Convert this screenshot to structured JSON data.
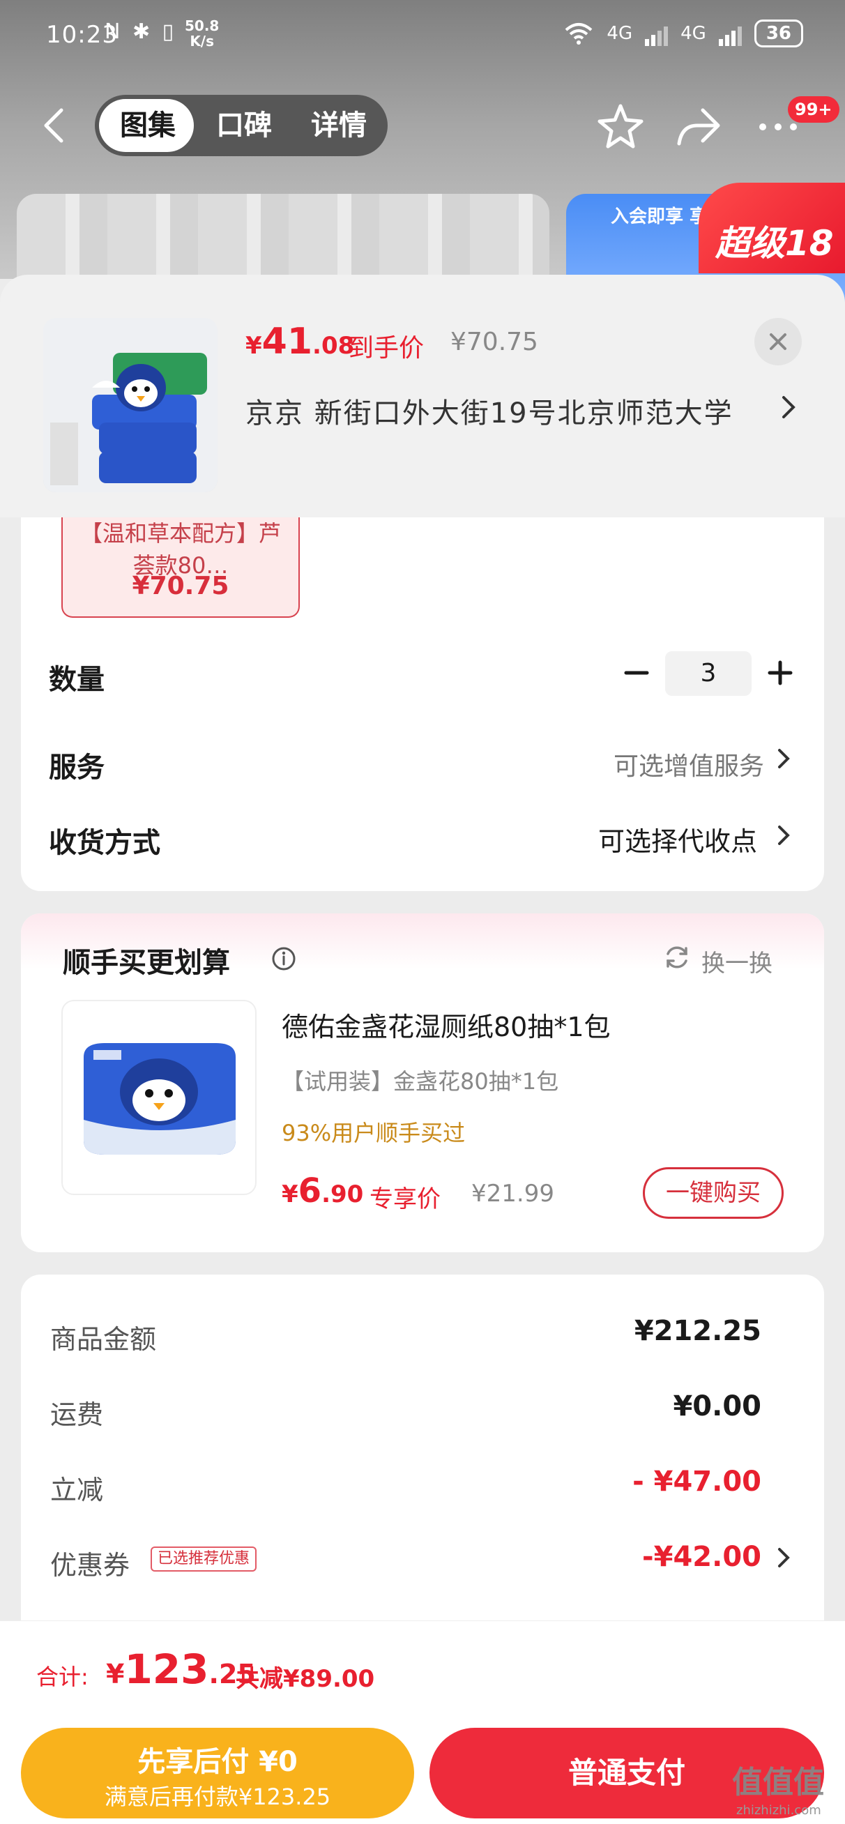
{
  "status_bar": {
    "time": "10:23",
    "left_icons": "N ✱ ▯",
    "net_speed": "50.8",
    "net_speed_unit": "K/s",
    "signal_1": "4G",
    "signal_2": "4G",
    "battery": "36"
  },
  "nav": {
    "tabs": [
      {
        "label": "图集",
        "active": true
      },
      {
        "label": "口碑",
        "active": false
      },
      {
        "label": "详情",
        "active": false
      }
    ],
    "badge": "99+"
  },
  "banner": {
    "side_text": "入会即享 享超",
    "super_tag": "超级18"
  },
  "product": {
    "price_currency": "¥",
    "price_int": "41",
    "price_dec": ".08",
    "price_label": "到手价",
    "original_price": "¥70.75",
    "address": "京京   新街口外大街19号北京师范大学"
  },
  "sku": {
    "name": "【温和草本配方】芦荟款80…",
    "price": "¥70.75"
  },
  "options": {
    "quantity_label": "数量",
    "quantity_value": "3",
    "service_label": "服务",
    "service_value": "可选增值服务",
    "delivery_label": "收货方式",
    "delivery_value": "可选择代收点"
  },
  "recommend": {
    "title": "顺手买更划算",
    "refresh_label": "换一换",
    "item_name": "德佑金盏花湿厕纸80抽*1包",
    "item_spec": "【试用装】金盏花80抽*1包",
    "item_bought": "93%用户顺手买过",
    "price_currency": "¥",
    "price_int": "6",
    "price_dec": ".90",
    "price_label": "专享价",
    "original_price": "¥21.99",
    "buy_label": "一键购买"
  },
  "summary": {
    "goods_label": "商品金额",
    "goods_value": "¥212.25",
    "shipping_label": "运费",
    "shipping_value": "¥0.00",
    "discount_label": "立减",
    "discount_value": "- ¥47.00",
    "coupon_label": "优惠券",
    "coupon_tag": "已选推荐优惠",
    "coupon_value": "-¥42.00"
  },
  "bottom": {
    "total_label": "合计:",
    "total_currency": "¥",
    "total_int": "123",
    "total_dec": ".25",
    "total_saved": "共减¥89.00",
    "pay_later_title": "先享后付 ¥0",
    "pay_later_sub": "满意后再付款¥123.25",
    "pay_normal": "普通支付",
    "watermark": "值值值",
    "watermark_sub": "zhizhizhi.com"
  },
  "colors": {
    "accent_red": "#e8202f",
    "pay_later": "#f9b21c",
    "pay_normal": "#ee2b3b"
  }
}
